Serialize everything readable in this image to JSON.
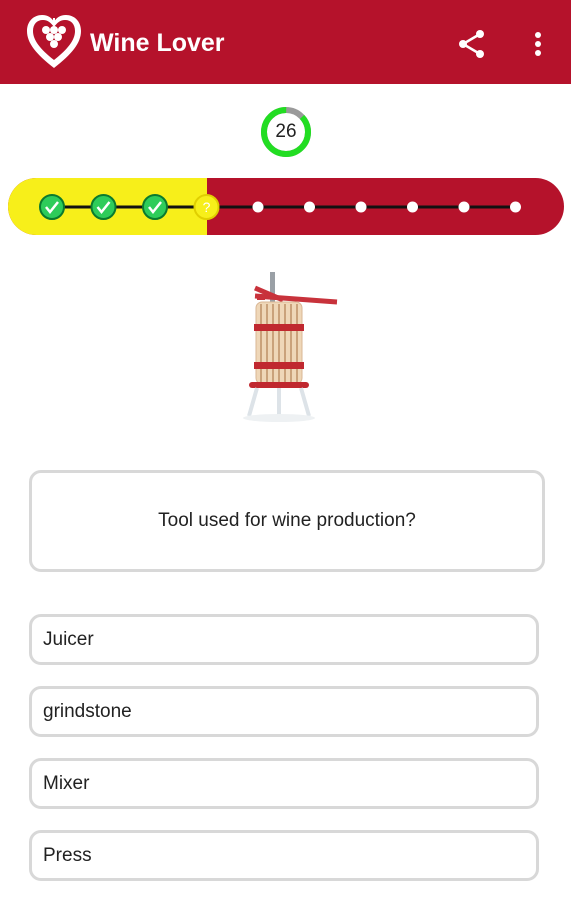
{
  "app_bar": {
    "title": "Wine Lover",
    "logo_icon": "heart-grapes-icon",
    "share_icon": "share-icon",
    "menu_icon": "more-vert-icon",
    "background": "#b5122b"
  },
  "timer": {
    "seconds_left": "26",
    "remaining_fraction": 0.87,
    "ring_color": "#22dd22",
    "track_color": "#9a9a9a"
  },
  "progress": {
    "total_steps": 10,
    "completed_steps": 3,
    "current_step": 4,
    "current_symbol": "?",
    "answered_color": "#f7ef1a",
    "pending_color": "#b5122b",
    "check_color": "#2ecc5a"
  },
  "question": {
    "image_icon": "wine-press-icon",
    "text": "Tool used for wine production?"
  },
  "answers": [
    {
      "label": "Juicer"
    },
    {
      "label": "grindstone"
    },
    {
      "label": "Mixer"
    },
    {
      "label": "Press"
    }
  ]
}
